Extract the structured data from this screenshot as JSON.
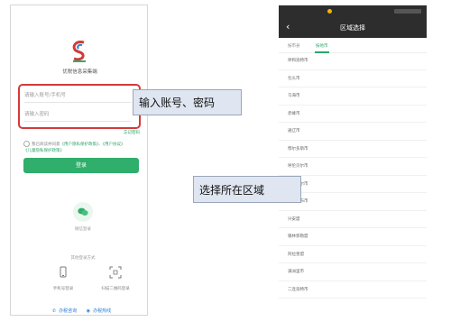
{
  "left_phone": {
    "app_name": "优税信息采集端",
    "account_placeholder": "请输入账号/手机号",
    "password_placeholder": "请输入密码",
    "forgot_password": "忘记密码",
    "agreement_prefix": "我已阅读并同意",
    "agreement_link1": "《用户隐私保护政策》",
    "agreement_and": "、",
    "agreement_link2": "《用户协议》",
    "agreement_link3": "《儿童隐私保护政策》",
    "login_button": "登录",
    "wechat_login": "微信登录",
    "other_methods": "其他登录方式",
    "option_sms": "手机号登录",
    "option_qr": "扫描二维码登录",
    "phone_link": "办税咨询",
    "service_link": "办税热线"
  },
  "callouts": {
    "login_hint": "输入账号、密码",
    "region_hint": "选择所在区域"
  },
  "right_phone": {
    "title": "区域选择",
    "tabs": [
      "按市县",
      "按地市"
    ],
    "regions": [
      "呼和浩特市",
      "包头市",
      "乌海市",
      "赤峰市",
      "通辽市",
      "鄂尔多斯市",
      "呼伦贝尔市",
      "巴彦淖尔市",
      "乌兰察布市",
      "兴安盟",
      "锡林郭勒盟",
      "阿拉善盟",
      "满洲里市",
      "二连浩特市"
    ]
  },
  "colors": {
    "accent": "#2fae6c",
    "highlight_border": "#d43a3a",
    "callout_bg": "#dfe6f1",
    "nav_bg": "#2d2d2d"
  }
}
